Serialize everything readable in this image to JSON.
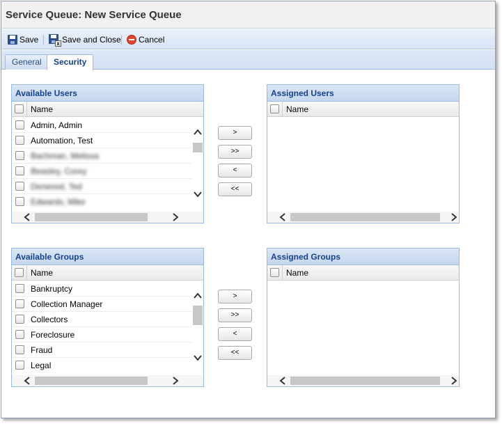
{
  "window": {
    "title": "Service Queue: New Service Queue"
  },
  "toolbar": {
    "save_label": "Save",
    "save_close_label": "Save and Close",
    "cancel_label": "Cancel",
    "icons": {
      "save": "floppy-disk-icon",
      "save_close": "floppy-disk-close-icon",
      "cancel": "cancel-circle-icon"
    }
  },
  "tabs": [
    {
      "label": "General",
      "active": false
    },
    {
      "label": "Security",
      "active": true
    }
  ],
  "available_users": {
    "title": "Available Users",
    "column": "Name",
    "rows": [
      {
        "name": "Admin, Admin",
        "blurred": false
      },
      {
        "name": "Automation, Test",
        "blurred": false
      },
      {
        "name": "Bachman, Melissa",
        "blurred": true
      },
      {
        "name": "Beasley, Corey",
        "blurred": true
      },
      {
        "name": "Derwood, Ted",
        "blurred": true
      },
      {
        "name": "Edwards, Mike",
        "blurred": true
      }
    ]
  },
  "assigned_users": {
    "title": "Assigned Users",
    "column": "Name",
    "rows": []
  },
  "available_groups": {
    "title": "Available Groups",
    "column": "Name",
    "rows": [
      {
        "name": "Bankruptcy"
      },
      {
        "name": "Collection Manager"
      },
      {
        "name": "Collectors"
      },
      {
        "name": "Foreclosure"
      },
      {
        "name": "Fraud"
      },
      {
        "name": "Legal"
      }
    ]
  },
  "assigned_groups": {
    "title": "Assigned Groups",
    "column": "Name",
    "rows": []
  },
  "move_buttons": {
    "add_selected": ">",
    "add_all": ">>",
    "remove_selected": "<",
    "remove_all": "<<"
  },
  "colors": {
    "panel_header_text": "#15428b",
    "panel_border": "#99bbe8",
    "toolbar_bg": "#d9e5f4"
  }
}
